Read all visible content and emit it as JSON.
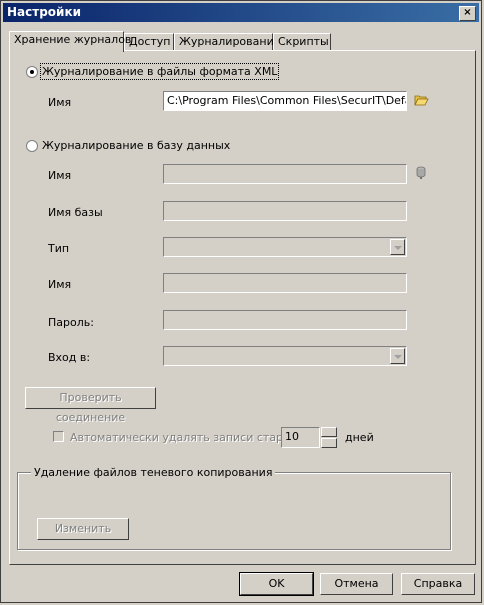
{
  "window": {
    "title": "Настройки",
    "close_label": "×"
  },
  "tabs": [
    {
      "label": "Хранение журналов",
      "active": true
    },
    {
      "label": "Доступ",
      "active": false
    },
    {
      "label": "Журналирование",
      "active": false
    },
    {
      "label": "Скрипты",
      "active": false
    }
  ],
  "xml_option": {
    "label": "Журналирование в файлы формата  XML",
    "checked": true
  },
  "xml_name": {
    "label": "Имя",
    "value": "C:\\Program Files\\Common Files\\SecurIT\\Default_"
  },
  "db_option": {
    "label": "Журналирование в базу данных",
    "checked": false
  },
  "db_fields": {
    "name_label": "Имя",
    "dbname_label": "Имя базы",
    "type_label": "Тип",
    "user_label": "Имя",
    "password_label": "Пароль:",
    "login_label": "Вход в:"
  },
  "check_connection_label": "Проверить соединение",
  "auto_delete": {
    "label": "Автоматически удалять записи старше",
    "value": "10",
    "unit": "дней"
  },
  "shadow_group": {
    "title": "Удаление файлов теневого копирования",
    "change_label": "Изменить"
  },
  "buttons": {
    "ok": "OK",
    "cancel": "Отмена",
    "help": "Справка"
  }
}
